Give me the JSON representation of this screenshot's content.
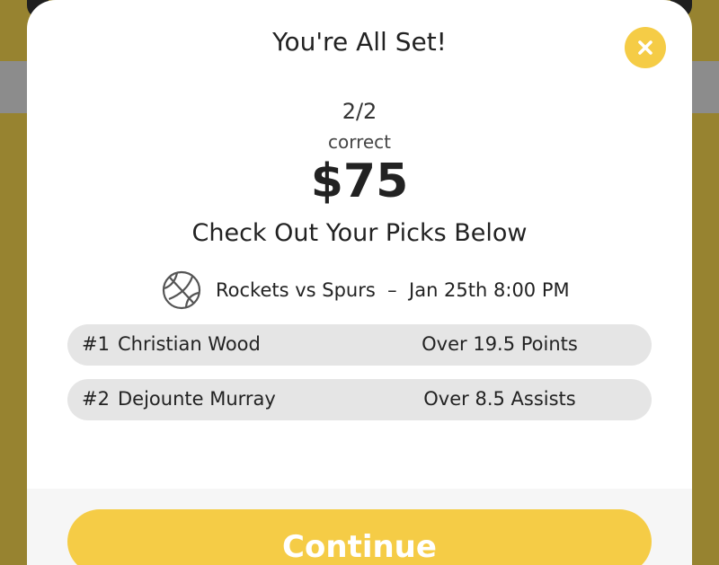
{
  "modal": {
    "title": "You're All Set!",
    "score": "2/2",
    "score_label": "correct",
    "amount": "$75",
    "subheading": "Check Out Your Picks Below",
    "close_icon": "close-icon"
  },
  "game": {
    "icon": "basketball-icon",
    "label": "Rockets vs Spurs  –  Jan 25th 8:00 PM"
  },
  "picks": [
    {
      "number": "#1",
      "player": "Christian Wood",
      "line": "Over 19.5 Points"
    },
    {
      "number": "#2",
      "player": "Dejounte Murray",
      "line": "Over 8.5 Assists"
    }
  ],
  "footer": {
    "continue_label": "Continue"
  },
  "colors": {
    "accent": "#f5cc46",
    "backdrop": "#978330",
    "pill": "#e5e5e5"
  }
}
